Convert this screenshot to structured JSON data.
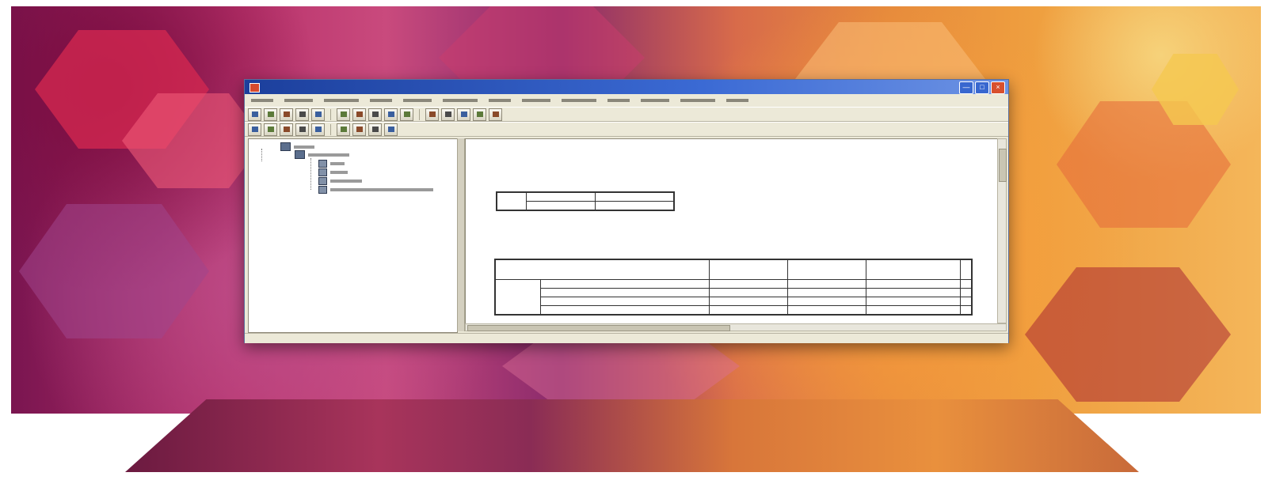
{
  "window": {
    "title": "",
    "controls": {
      "minimize": "",
      "maximize": "",
      "close": ""
    }
  },
  "menubar": {
    "items": []
  },
  "toolbars": {
    "row1_icons": [
      "open-icon",
      "save-icon",
      "print-icon",
      "export-icon",
      "undo-icon",
      "redo-icon",
      "goto-icon",
      "variables-icon",
      "chart-icon",
      "find-icon",
      "insert-icon",
      "select-icon",
      "show-all-icon",
      "value-labels-icon",
      "use-sets-icon"
    ],
    "row2_icons": [
      "back-icon",
      "forward-icon",
      "expand-icon",
      "collapse-icon",
      "show-icon",
      "hide-icon",
      "insert-heading-icon",
      "insert-title-icon",
      "insert-text-icon"
    ]
  },
  "navigator": {
    "nodes": []
  },
  "output": {
    "heading": "",
    "statistics_table": {
      "title": "",
      "rows": []
    },
    "frequency_table": {
      "title": "",
      "columns": [],
      "rows": []
    }
  },
  "colors": {
    "title_bar": "#1c3f9c",
    "window_chrome": "#ece9d8",
    "background_magenta": "#b8326b",
    "background_orange": "#ef9f3f"
  }
}
